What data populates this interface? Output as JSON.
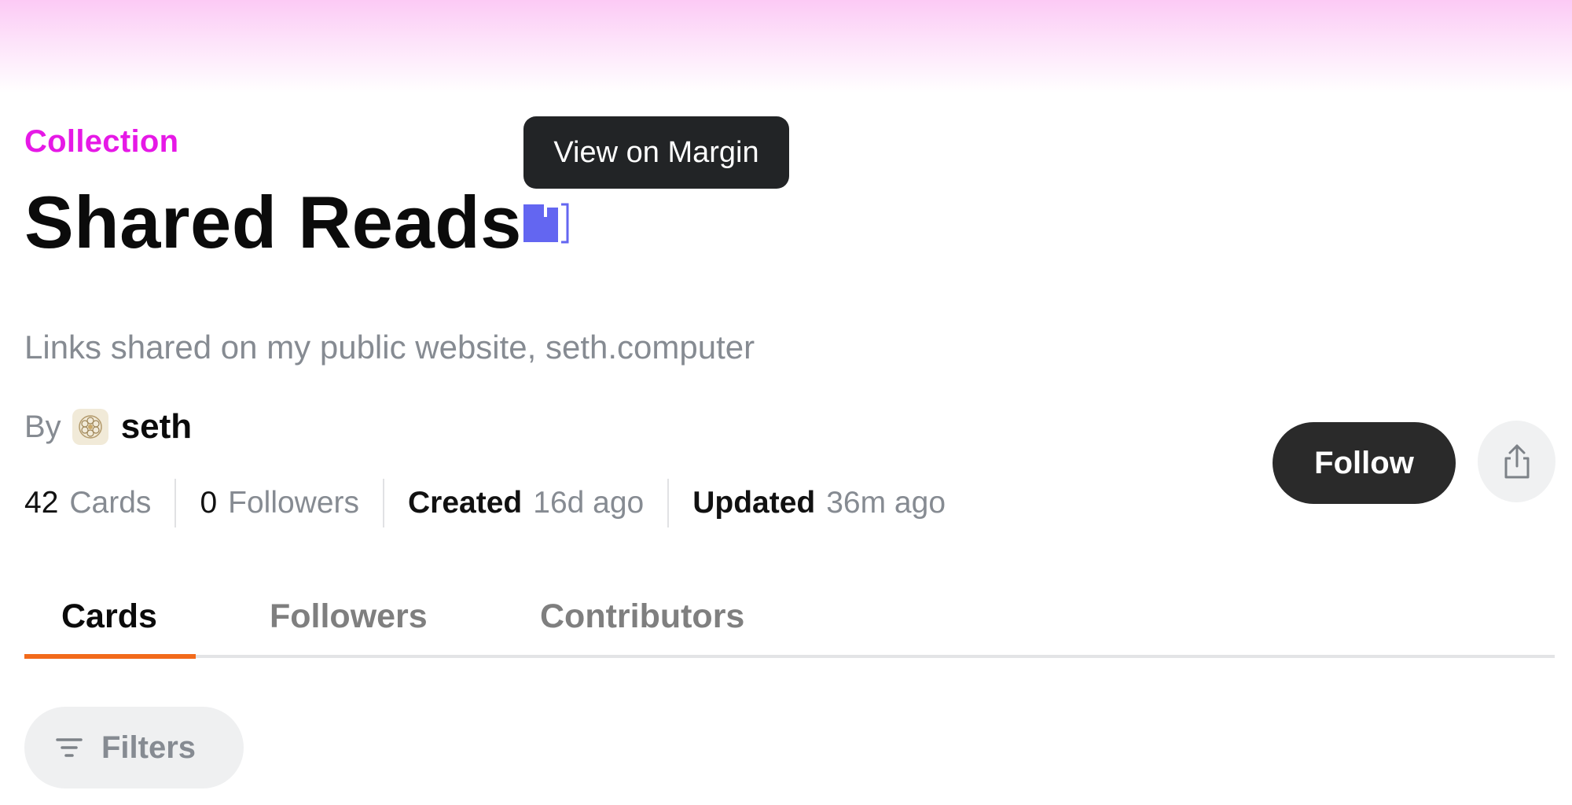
{
  "header": {
    "eyebrow": "Collection",
    "title": "Shared Reads",
    "tooltip": "View on Margin",
    "description": "Links shared on my public website, seth.computer"
  },
  "owner": {
    "by_label": "By",
    "name": "seth"
  },
  "stats": {
    "cards_value": "42",
    "cards_label": "Cards",
    "followers_value": "0",
    "followers_label": "Followers",
    "created_label": "Created",
    "created_value": "16d ago",
    "updated_label": "Updated",
    "updated_value": "36m ago"
  },
  "actions": {
    "follow_label": "Follow",
    "share_icon": "share-icon"
  },
  "tabs": [
    {
      "label": "Cards",
      "active": true
    },
    {
      "label": "Followers",
      "active": false
    },
    {
      "label": "Contributors",
      "active": false
    }
  ],
  "filters": {
    "label": "Filters",
    "icon": "filter-icon"
  },
  "colors": {
    "eyebrow": "#e619e6",
    "active_tab_underline": "#f26a1b",
    "follow_button": "#2a2a2a",
    "margin_icon": "#6366f1"
  }
}
